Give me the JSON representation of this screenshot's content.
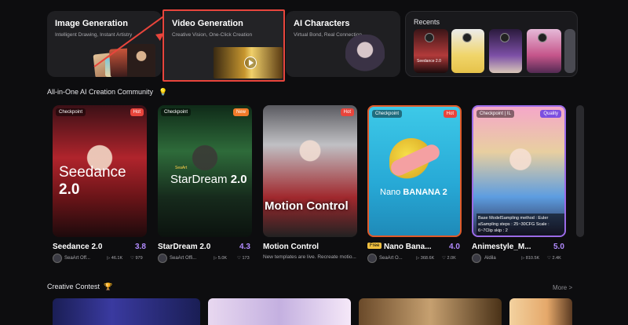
{
  "features": [
    {
      "title": "Image Generation",
      "subtitle": "Intelligent Drawing, Instant Artistry"
    },
    {
      "title": "Video Generation",
      "subtitle": "Creative Vision, One-Click Creation"
    },
    {
      "title": "AI Characters",
      "subtitle": "Virtual Bond, Real Connection"
    }
  ],
  "recents": {
    "title": "Recents",
    "items": [
      {
        "label": "Seedance 2.0"
      },
      {
        "label": ""
      },
      {
        "label": ""
      },
      {
        "label": ""
      }
    ]
  },
  "community": {
    "title": "All-in-One AI Creation Community",
    "cards": [
      {
        "tag": "Checkpoint",
        "badge": "Hot",
        "art_title_a": "Seedance",
        "art_title_b": "2.0",
        "art_brand": "",
        "title": "Seedance 2.0",
        "score": "3.8",
        "author": "SeaArt Off...",
        "views": "46.1K",
        "likes": "979"
      },
      {
        "tag": "Checkpoint",
        "badge": "New",
        "art_title_a": "StarDream",
        "art_title_b": "2.0",
        "art_brand": "SeaArt",
        "title": "StarDream 2.0",
        "score": "4.3",
        "author": "SeaArt Offi...",
        "views": "5.0K",
        "likes": "173"
      },
      {
        "tag": "",
        "badge": "Hot",
        "art_title_a": "Motion Control",
        "art_title_b": "",
        "art_brand": "",
        "title": "Motion Control",
        "score": "",
        "author": "New templates are live. Recreate motio...",
        "views": "",
        "likes": ""
      },
      {
        "tag": "Checkpoint",
        "badge": "Hot",
        "art_title_a": "Nano",
        "art_title_b": "BANANA 2",
        "art_brand": "",
        "title": "Nano Bana...",
        "score": "4.0",
        "free": "Free",
        "author": "SeaArt O...",
        "views": "368.6K",
        "likes": "2.0K"
      },
      {
        "tag": "Checkpoint | IL",
        "badge": "Quality",
        "art_title_a": "",
        "art_title_b": "",
        "art_brand": "",
        "art_desc": "Base ModelSampling method : Euler aSampling steps : 25~30CFG Scale : 6~7Clip skip : 2",
        "title": "Animestyle_M...",
        "score": "5.0",
        "author": "Aldila",
        "views": "810.5K",
        "likes": "2.4K"
      }
    ]
  },
  "contest": {
    "title": "Creative Contest",
    "more": "More >"
  },
  "colors": {
    "accent": "#b28bff",
    "highlight": "#e8453c",
    "hot": "#e8453c",
    "quality": "#7c4fe0"
  }
}
